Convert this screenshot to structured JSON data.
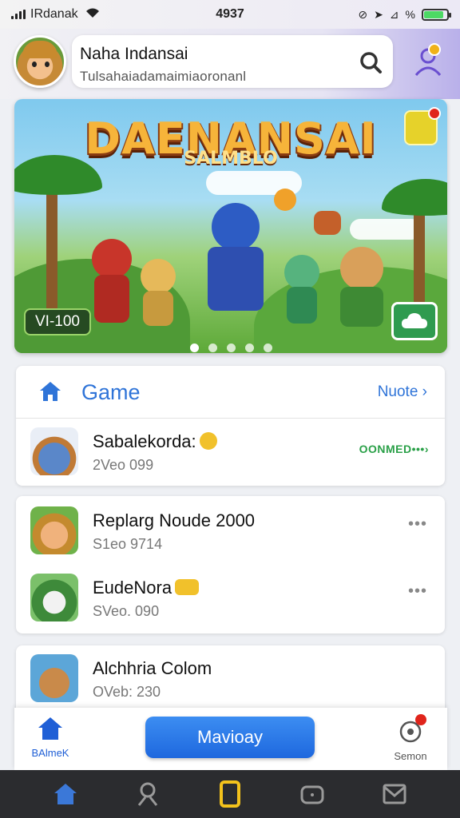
{
  "status_bar": {
    "carrier": "IRdanak",
    "time": "4937",
    "percent": "%",
    "battery_level": 0.85
  },
  "header": {
    "profile_name": "Naha Indansai",
    "search_text": "Tulsahaiadamaimiaoronanl"
  },
  "banner": {
    "title": "DAENANSAI",
    "subtitle": "SALMBLO",
    "version_chip": "VI-100",
    "slides": 5,
    "active_slide": 0
  },
  "game_section": {
    "title": "Game",
    "more_label": "Nuote ›"
  },
  "games": [
    {
      "name": "Sabalekorda:",
      "meta": "2Veo  099",
      "action": "OONMED•••›"
    },
    {
      "name": "Replarg Noude 2000",
      "meta": "S1eo  9714",
      "action": "•••"
    },
    {
      "name": "EudeNora",
      "meta": "SVeo. 090",
      "action": "•••"
    },
    {
      "name": "Alchhria Colom",
      "meta": "OVeb: 230",
      "action": ""
    }
  ],
  "bottom_bar": {
    "left_label": "BAlmeK",
    "cta_label": "Mavioay",
    "right_label": "Semon"
  },
  "colors": {
    "accent": "#2f74d8",
    "cta": "#1e68de",
    "success": "#2aa048",
    "badge": "#e0241b"
  }
}
